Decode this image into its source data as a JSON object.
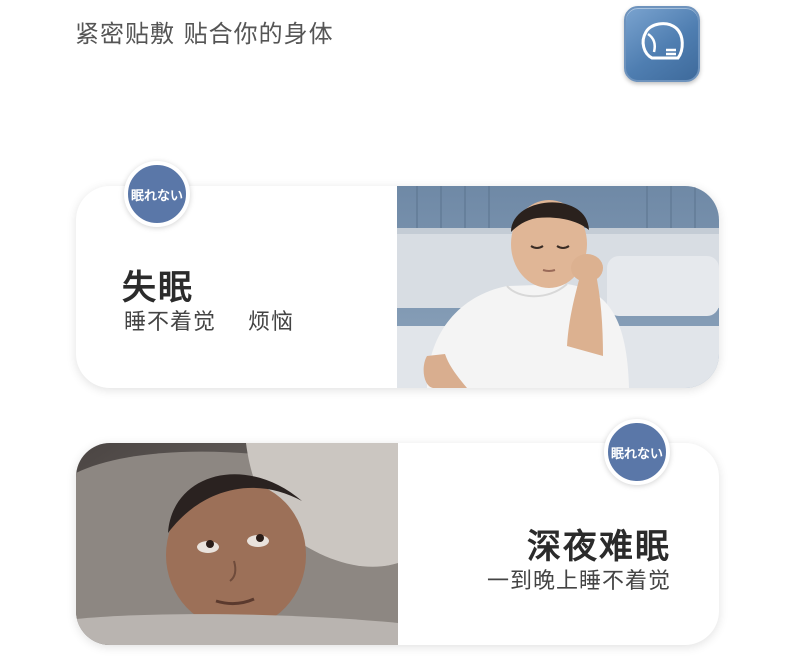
{
  "header": {
    "headline": "紧密贴敷 贴合你的身体",
    "app_icon": "bandage-patch-icon",
    "accent_color": "#5a77a8"
  },
  "cards": [
    {
      "badge": "眠れない",
      "title": "失眠",
      "subtitle": "睡不着觉    烦恼",
      "photo": "man-sitting-on-bed-tired-photo"
    },
    {
      "badge": "眠れない",
      "title": "深夜难眠",
      "subtitle": "一到晚上睡不着觉",
      "photo": "man-lying-awake-in-bed-photo"
    }
  ]
}
